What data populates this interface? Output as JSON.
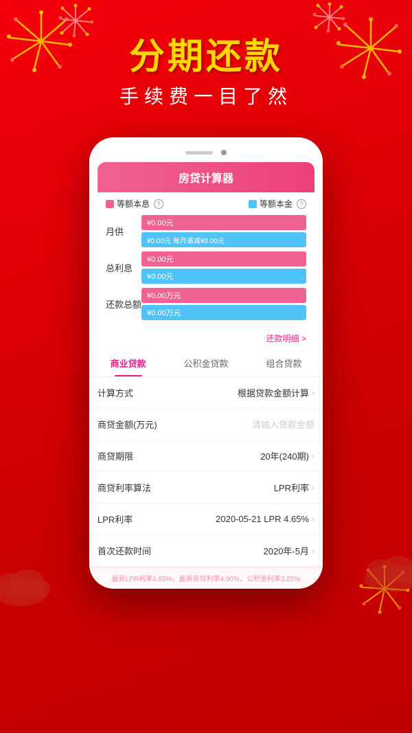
{
  "background": {
    "color": "#e8001c"
  },
  "header": {
    "title": "分期还款",
    "subtitle": "手续费一目了然"
  },
  "calculator": {
    "title": "房贷计算器",
    "legend": {
      "equal_principal_interest": "等额本息",
      "equal_principal": "等额本金"
    },
    "monthly_payment": {
      "label": "月供",
      "red_value": "¥0.00元",
      "blue_value": "¥0.00元 每月递减¥0.00元"
    },
    "total_interest": {
      "label": "总利息",
      "red_value": "¥0.00元",
      "blue_value": "¥0.00元"
    },
    "total_repayment": {
      "label": "还款总额",
      "red_value": "¥0.00万元",
      "blue_value": "¥0.00万元"
    },
    "repay_detail_link": "还款明细 >"
  },
  "tabs": [
    {
      "label": "商业贷款",
      "active": true
    },
    {
      "label": "公积金贷款",
      "active": false
    },
    {
      "label": "组合贷款",
      "active": false
    }
  ],
  "form_rows": [
    {
      "label": "计算方式",
      "value": "根据贷款金额计算",
      "has_arrow": true,
      "is_placeholder": false
    },
    {
      "label": "商贷金额(万元)",
      "value": "请输入贷款金额",
      "has_arrow": false,
      "is_placeholder": true
    },
    {
      "label": "商贷期限",
      "value": "20年(240期)",
      "has_arrow": true,
      "is_placeholder": false
    },
    {
      "label": "商贷利率算法",
      "value": "LPR利率",
      "has_arrow": true,
      "is_placeholder": false
    },
    {
      "label": "LPR利率",
      "value": "2020-05-21 LPR 4.65%",
      "has_arrow": true,
      "is_placeholder": false
    },
    {
      "label": "首次还款时间",
      "value": "2020年-5月",
      "has_arrow": true,
      "is_placeholder": false
    }
  ],
  "bottom_note": "最新LPR利率4.65%，最新商贷利率4.90%，公积金利率3.25%"
}
